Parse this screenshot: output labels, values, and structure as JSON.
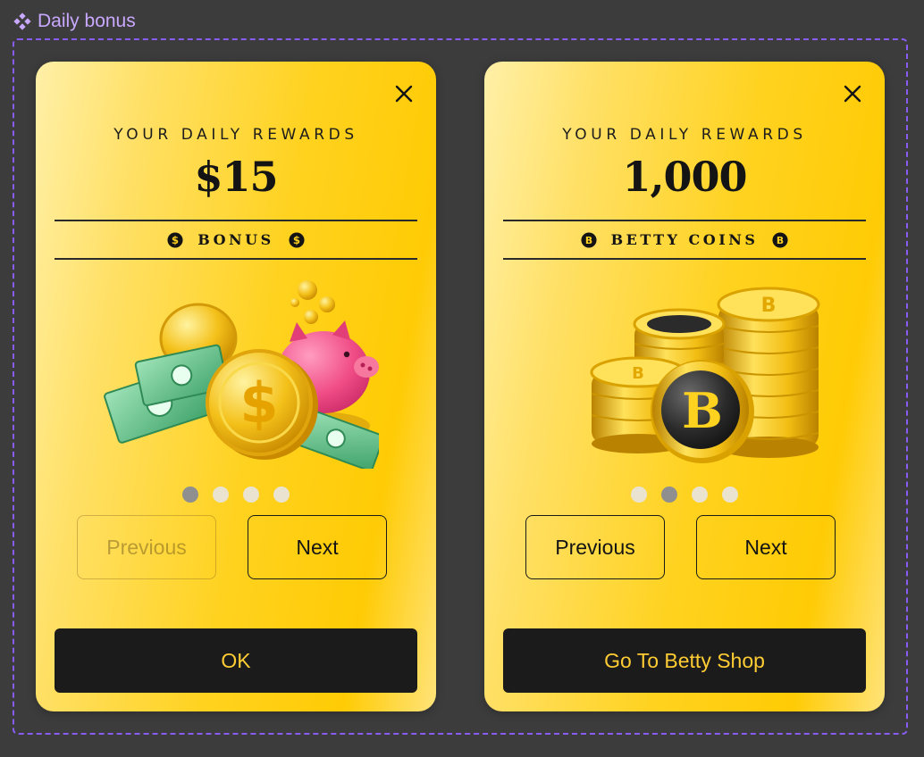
{
  "frame": {
    "title": "Daily bonus"
  },
  "cards": [
    {
      "eyebrow": "YOUR DAILY REWARDS",
      "amount": "$15",
      "currency_label": "BONUS",
      "currency_icon": "dollar-coin-icon",
      "illustration": "piggy-bank-coins-cash-illustration",
      "pagination": {
        "total": 4,
        "active": 1
      },
      "previous_label": "Previous",
      "previous_enabled": false,
      "next_label": "Next",
      "cta_label": "OK"
    },
    {
      "eyebrow": "YOUR DAILY REWARDS",
      "amount": "1,000",
      "currency_label": "BETTY COINS",
      "currency_icon": "betty-coin-icon",
      "illustration": "betty-coin-stacks-illustration",
      "pagination": {
        "total": 4,
        "active": 2
      },
      "previous_label": "Previous",
      "previous_enabled": true,
      "next_label": "Next",
      "cta_label": "Go To Betty Shop"
    }
  ],
  "colors": {
    "canvas": "#3c3c3c",
    "frame_accent": "#8a5cf6",
    "card_gold": "#ffd21f",
    "cta_background": "#1b1b1b",
    "cta_text": "#ffcc33",
    "dot_active": "#8f8f8f",
    "dot_inactive": "#e9e3cf"
  }
}
